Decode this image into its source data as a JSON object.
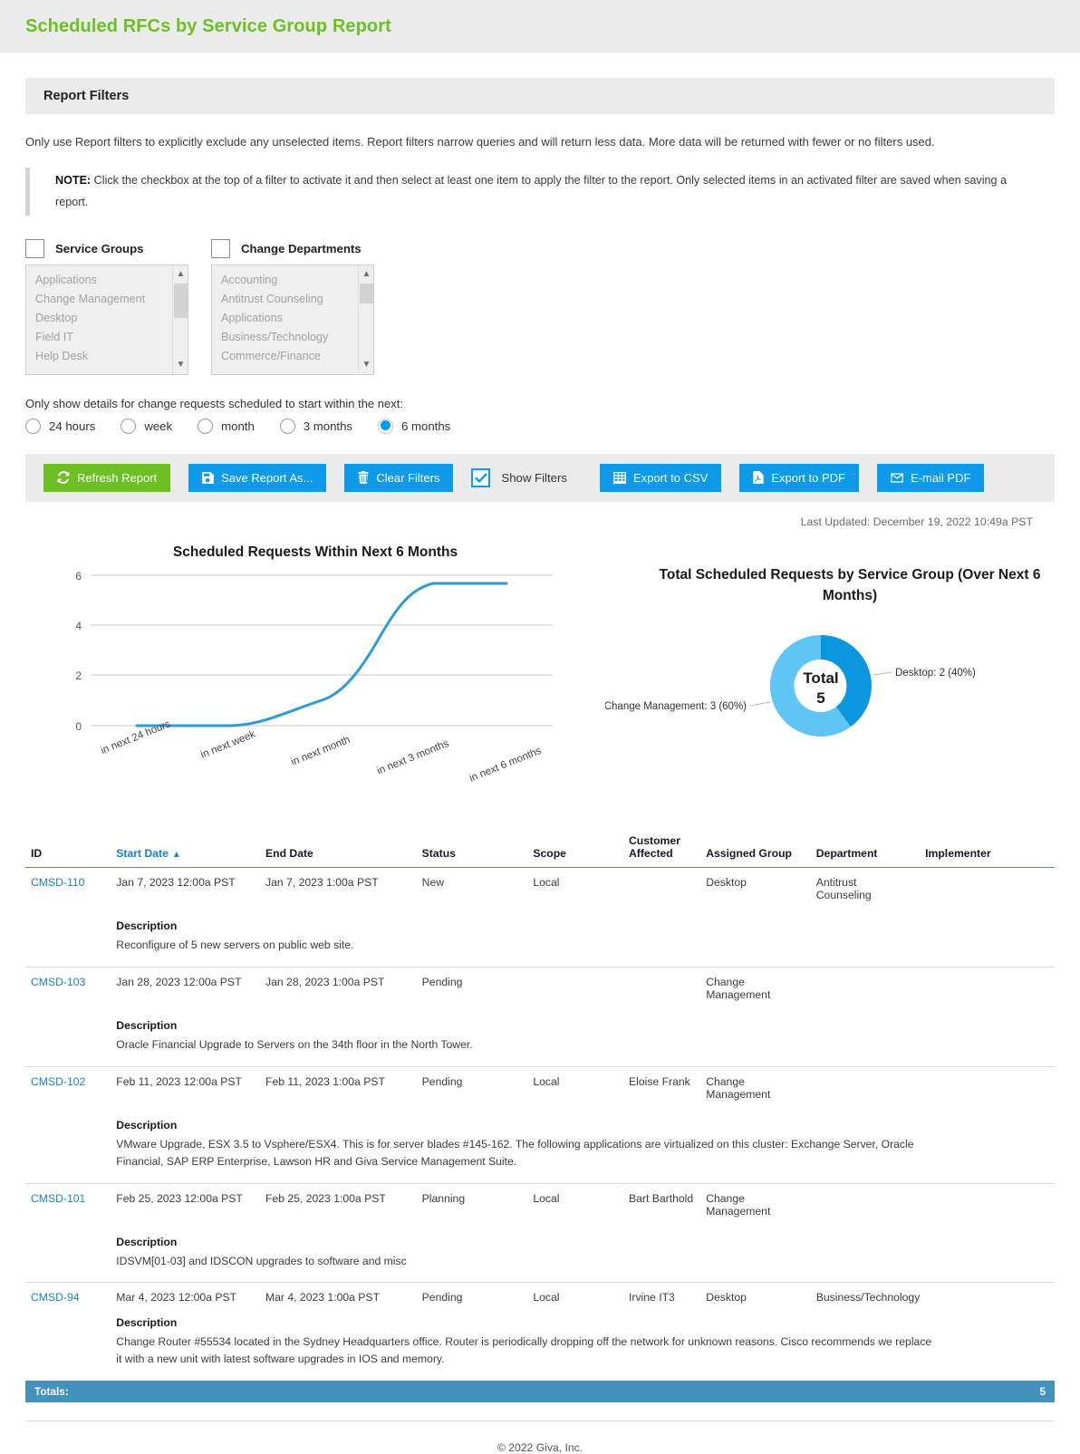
{
  "header": {
    "title": "Scheduled RFCs by Service Group Report"
  },
  "filters_panel": {
    "heading": "Report Filters",
    "intro": "Only use Report filters to explicitly exclude any unselected items. Report filters narrow queries and will return less data. More data will be returned with fewer or no filters used.",
    "note_lead": "NOTE:",
    "note_text": " Click the checkbox at the top of a filter to activate it and then select at least one item to apply the filter to the report. Only selected items in an activated filter are saved when saving a report.",
    "service_groups": {
      "label": "Service Groups",
      "checked": false,
      "items": [
        "Applications",
        "Change Management",
        "Desktop",
        "Field IT",
        "Help Desk"
      ]
    },
    "change_departments": {
      "label": "Change Departments",
      "checked": false,
      "items": [
        "Accounting",
        "Antitrust Counseling",
        "Applications",
        "Business/Technology",
        "Commerce/Finance"
      ]
    },
    "range_prompt": "Only show details for change requests scheduled to start within the next:",
    "range_options": [
      {
        "label": "24 hours",
        "selected": false
      },
      {
        "label": "week",
        "selected": false
      },
      {
        "label": "month",
        "selected": false
      },
      {
        "label": "3 months",
        "selected": false
      },
      {
        "label": "6 months",
        "selected": true
      }
    ]
  },
  "toolbar": {
    "refresh_label": "Refresh Report",
    "save_label": "Save Report As...",
    "clear_label": "Clear Filters",
    "show_filters_label": "Show Filters",
    "show_filters_checked": true,
    "export_csv_label": "Export to CSV",
    "export_pdf_label": "Export to PDF",
    "email_pdf_label": "E-mail PDF"
  },
  "last_updated": "Last Updated: December 19, 2022 10:49a PST",
  "colors": {
    "brand_green": "#6cc024",
    "brand_blue": "#0d9ae8",
    "link_blue": "#1782c5",
    "totals_blue": "#4292bd",
    "donut_dark": "#0d96e0",
    "donut_light": "#5fc5f5",
    "line": "#2e9bd6"
  },
  "chart_data": [
    {
      "type": "line",
      "title": "Scheduled Requests Within Next 6 Months",
      "categories": [
        "in next 24 hours",
        "in next week",
        "in next month",
        "in next 3 months",
        "in next 6 months"
      ],
      "values": [
        0,
        0,
        1,
        5,
        5
      ],
      "series": [
        {
          "name": "Scheduled Requests",
          "values": [
            0,
            0,
            1,
            5,
            5
          ]
        }
      ],
      "xlabel": "",
      "ylabel": "",
      "ylim": [
        0,
        6
      ],
      "yticks": [
        0,
        2,
        4,
        6
      ],
      "grid": true,
      "legend": "none",
      "smooth": true
    },
    {
      "type": "pie",
      "variant": "donut",
      "title": "Total Scheduled Requests by Service Group (Over Next 6 Months)",
      "center_label": "Total",
      "center_value": "5",
      "total": 5,
      "labels": [
        "Desktop",
        "Change Management"
      ],
      "values": [
        2,
        3
      ],
      "percents": [
        40,
        60
      ],
      "annotations": [
        "Desktop: 2 (40%)",
        "Change Management: 3 (60%)"
      ],
      "colors": [
        "#0d96e0",
        "#5fc5f5"
      ],
      "legend": "callout-labels"
    }
  ],
  "table": {
    "columns": [
      "ID",
      "Start Date",
      "End Date",
      "Status",
      "Scope",
      "Customer Affected",
      "Assigned Group",
      "Department",
      "Implementer"
    ],
    "sorted_column": "Start Date",
    "sort_direction": "asc",
    "description_label": "Description",
    "rows": [
      {
        "id": "CMSD-110",
        "start_date": "Jan 7, 2023 12:00a PST",
        "end_date": "Jan 7, 2023 1:00a PST",
        "status": "New",
        "scope": "Local",
        "customer_affected": "",
        "assigned_group": "Desktop",
        "department": "Antitrust Counseling",
        "implementer": "",
        "description": "Reconfigure of 5 new servers on public web site."
      },
      {
        "id": "CMSD-103",
        "start_date": "Jan 28, 2023 12:00a PST",
        "end_date": "Jan 28, 2023 1:00a PST",
        "status": "Pending",
        "scope": "",
        "customer_affected": "",
        "assigned_group": "Change Management",
        "department": "",
        "implementer": "",
        "description": "Oracle Financial Upgrade to Servers on the 34th floor in the North Tower."
      },
      {
        "id": "CMSD-102",
        "start_date": "Feb 11, 2023 12:00a PST",
        "end_date": "Feb 11, 2023 1:00a PST",
        "status": "Pending",
        "scope": "Local",
        "customer_affected": "Eloise Frank",
        "assigned_group": "Change Management",
        "department": "",
        "implementer": "",
        "description": "VMware Upgrade, ESX 3.5 to Vsphere/ESX4. This is for server blades #145-162. The following applications are virtualized on this cluster: Exchange Server, Oracle Financial, SAP ERP Enterprise, Lawson HR and Giva Service Management Suite."
      },
      {
        "id": "CMSD-101",
        "start_date": "Feb 25, 2023 12:00a PST",
        "end_date": "Feb 25, 2023 1:00a PST",
        "status": "Planning",
        "scope": "Local",
        "customer_affected": "Bart Barthold",
        "assigned_group": "Change Management",
        "department": "",
        "implementer": "",
        "description": "IDSVM[01-03] and IDSCON upgrades to software and misc"
      },
      {
        "id": "CMSD-94",
        "start_date": "Mar 4, 2023 12:00a PST",
        "end_date": "Mar 4, 2023 1:00a PST",
        "status": "Pending",
        "scope": "Local",
        "customer_affected": "Irvine IT3",
        "assigned_group": "Desktop",
        "department": "Business/Technology",
        "implementer": "",
        "description": "Change Router #55534 located in the Sydney Headquarters office. Router is periodically dropping off the network for unknown reasons. Cisco recommends we replace it with a new unit with latest software upgrades in IOS and memory."
      }
    ],
    "totals_label": "Totals:",
    "totals_value": "5"
  },
  "footer": {
    "copyright": "© 2022 Giva, Inc."
  }
}
